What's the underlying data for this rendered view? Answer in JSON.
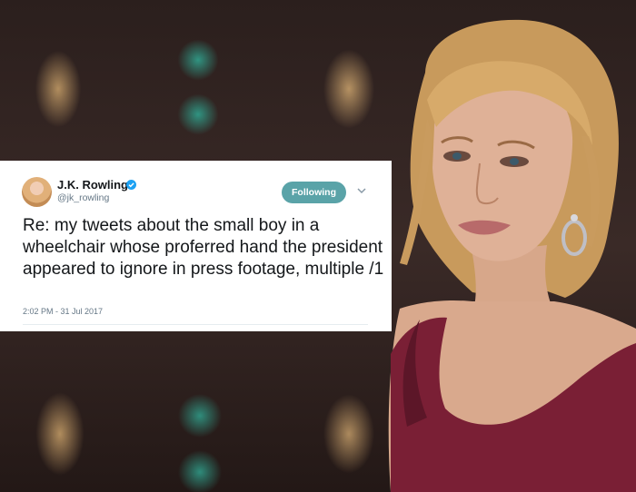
{
  "tweet": {
    "display_name": "J.K. Rowling",
    "handle": "@jk_rowling",
    "follow_label": "Following",
    "text": "Re: my tweets about the small boy in a wheelchair whose proferred hand the president appeared to ignore in press footage, multiple /1",
    "timestamp": "2:02 PM - 31 Jul 2017"
  },
  "colors": {
    "follow_button": "#5aa3a8",
    "verified_badge": "#1da1f2",
    "dress": "#7a1f35",
    "background": "#2b1f1d"
  },
  "icons": {
    "verified": "verified-badge-icon",
    "caret": "chevron-down-icon"
  }
}
